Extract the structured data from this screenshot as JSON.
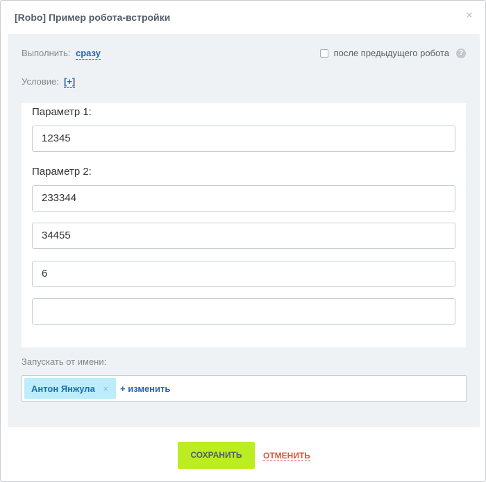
{
  "dialog": {
    "title": "[Robo] Пример робота-встройки",
    "close_icon": "×"
  },
  "run": {
    "label": "Выполнить:",
    "value": "сразу",
    "after_previous_label": "после предыдущего робота",
    "after_previous_checked": false,
    "help_icon": "?"
  },
  "condition": {
    "label": "Условие:",
    "add_label": "[+]"
  },
  "params": {
    "param1": {
      "label": "Параметр 1:",
      "value": "12345"
    },
    "param2": {
      "label": "Параметр 2:",
      "values": [
        "233344",
        "34455",
        "6",
        ""
      ]
    }
  },
  "run_as": {
    "label": "Запускать от имени:",
    "user": "Антон Янжула",
    "remove_icon": "×",
    "change_label": "+ изменить"
  },
  "footer": {
    "save_label": "СОХРАНИТЬ",
    "cancel_label": "ОТМЕНИТЬ"
  },
  "colors": {
    "accent_link": "#2067b0",
    "save_button": "#bbed21",
    "cancel_link": "#e2533a",
    "panel_bg": "#eef2f4",
    "user_chip": "#bcedfc"
  }
}
